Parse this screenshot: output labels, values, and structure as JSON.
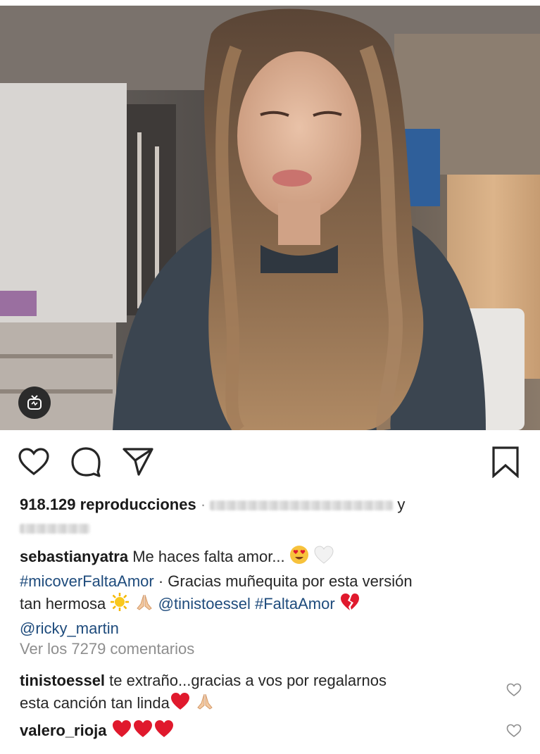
{
  "post": {
    "views_count": "918.129",
    "views_label": "reproducciones",
    "separator": "·",
    "and_label": "y"
  },
  "caption": {
    "username": "sebastianyatra",
    "text_line1": "Me haces falta amor...",
    "hashtag1": "#micoverFaltaAmor",
    "text_line2": "· Gracias muñequita por esta versión",
    "text_line3": "tan hermosa",
    "mention1": "@tinistoessel",
    "hashtag2": "#FaltaAmor",
    "mention2": "@ricky_martin"
  },
  "view_comments": "Ver los 7279 comentarios",
  "comments": [
    {
      "username": "tinistoessel",
      "text_a": "te extraño...gracias a vos por regalarnos",
      "text_b": "esta canción tan linda"
    },
    {
      "username": "valero_rioja",
      "text_a": "",
      "text_b": ""
    }
  ],
  "icons": {
    "like": "heart-outline-icon",
    "comment": "speech-bubble-icon",
    "share": "paper-plane-icon",
    "save": "bookmark-icon",
    "igtv": "igtv-icon"
  },
  "colors": {
    "link": "#1e4b7c",
    "muted": "#8e8e8e",
    "heart": "#e0192d"
  }
}
